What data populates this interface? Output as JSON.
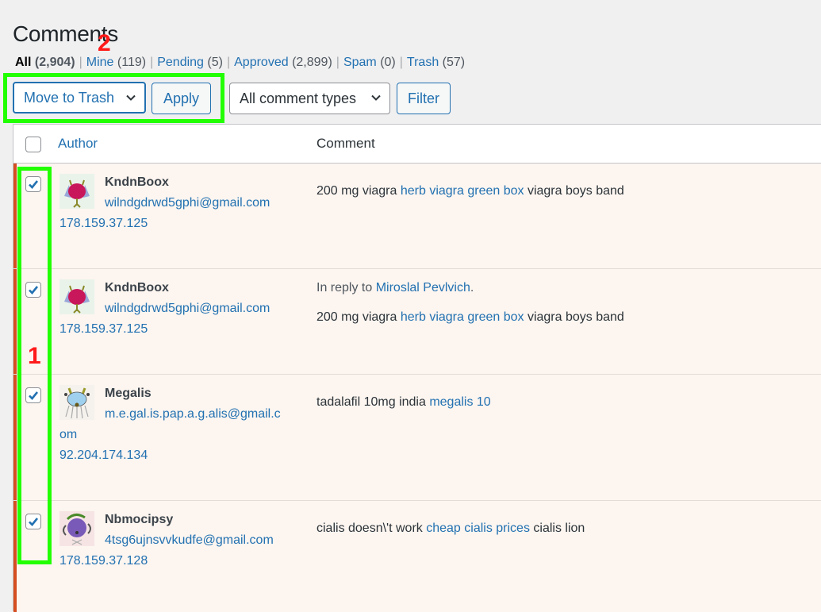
{
  "page": {
    "title": "Comments"
  },
  "filters": [
    {
      "label": "All",
      "count": "(2,904)",
      "current": true
    },
    {
      "label": "Mine",
      "count": "(119)",
      "current": false
    },
    {
      "label": "Pending",
      "count": "(5)",
      "current": false
    },
    {
      "label": "Approved",
      "count": "(2,899)",
      "current": false
    },
    {
      "label": "Spam",
      "count": "(0)",
      "current": false
    },
    {
      "label": "Trash",
      "count": "(57)",
      "current": false
    }
  ],
  "toolbar": {
    "bulk_action_selected": "Move to Trash",
    "apply_label": "Apply",
    "comment_type_selected": "All comment types",
    "filter_label": "Filter"
  },
  "annotations": {
    "step1": "1",
    "step2": "2"
  },
  "colors": {
    "accent": "#2271b1",
    "unapproved_bar": "#d54e21",
    "highlight_box": "#22ff00",
    "annotation": "#ff1a1a",
    "row_bg": "#fcf5f0"
  },
  "table": {
    "columns": {
      "author": "Author",
      "comment": "Comment"
    },
    "rows": [
      {
        "checked": true,
        "avatar": "red-monster-avatar",
        "author": "KndnBoox",
        "email": "wilndgdrwd5gphi@gmail.com",
        "ip": "178.159.37.125",
        "in_reply_prefix": "",
        "in_reply_to": "",
        "text_before": "200 mg viagra ",
        "link_text": "herb viagra green box",
        "text_after": " viagra boys band"
      },
      {
        "checked": true,
        "avatar": "red-monster-avatar",
        "author": "KndnBoox",
        "email": "wilndgdrwd5gphi@gmail.com",
        "ip": "178.159.37.125",
        "in_reply_prefix": "In reply to ",
        "in_reply_to": "Miroslal Pevlvich",
        "text_before": "200 mg viagra ",
        "link_text": "herb viagra green box",
        "text_after": " viagra boys band"
      },
      {
        "checked": true,
        "avatar": "blue-monster-avatar",
        "author": "Megalis",
        "email_line1": "m.e.gal.is.pap.a.g.alis@gmail.c",
        "email_line2": "om",
        "ip": "92.204.174.134",
        "text_before": "tadalafil 10mg india ",
        "link_text": "megalis 10",
        "text_after": ""
      },
      {
        "checked": true,
        "avatar": "purple-monster-avatar",
        "author": "Nbmocipsy",
        "email": "4tsg6ujnsvvkudfe@gmail.com",
        "ip": "178.159.37.128",
        "text_before": "cialis doesn\\'t work ",
        "link_text": "cheap cialis prices",
        "text_after": " cialis lion"
      }
    ]
  }
}
